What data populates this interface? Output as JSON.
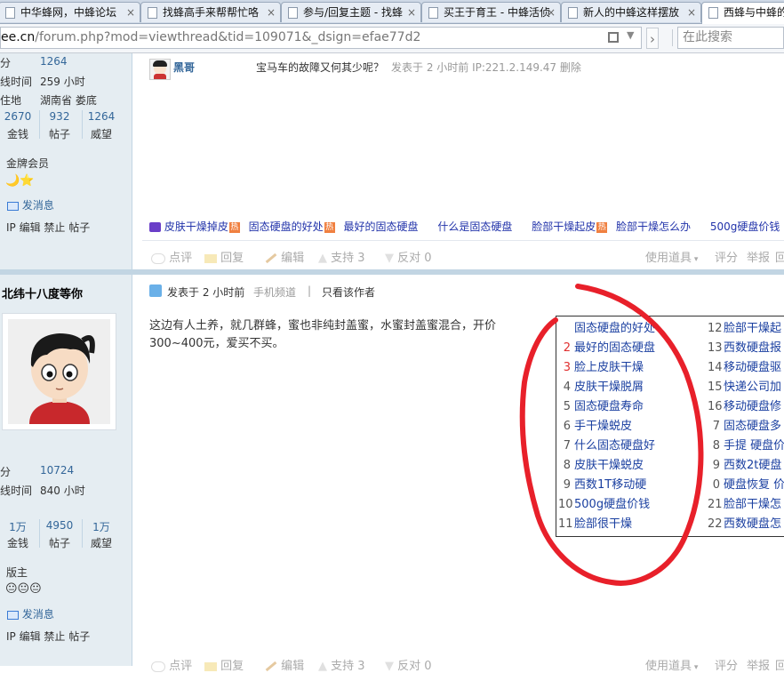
{
  "tabs": [
    {
      "title": "中华蜂网，中蜂论坛",
      "close": "×"
    },
    {
      "title": "找蜂高手来帮帮忙咯",
      "close": "×"
    },
    {
      "title": "参与/回复主题 - 找蜂",
      "close": "×"
    },
    {
      "title": "买王于育王 - 中蜂活侦",
      "close": "×"
    },
    {
      "title": "新人的中蜂这样摆放",
      "close": "×"
    },
    {
      "title": "西蜂与中蜂的",
      "close": ""
    }
  ],
  "address": {
    "host": "ee.cn",
    "path": "/forum.php?mod=viewthread&tid=109071&_dsign=efae77d2",
    "search_placeholder": "在此搜索",
    "forward": "›"
  },
  "user1": {
    "points_label": "分",
    "points": "1264",
    "online_label": "线时间",
    "online": "259 小时",
    "location_label": "住地",
    "location": "湖南省 娄底",
    "stats": [
      {
        "value": "2670",
        "label": "金钱"
      },
      {
        "value": "932",
        "label": "帖子"
      },
      {
        "value": "1264",
        "label": "威望"
      }
    ],
    "group": "金牌会员",
    "badges": "🌙⭐",
    "message": "发消息",
    "admin_links": "IP 编辑 禁止 帖子"
  },
  "reply": {
    "author": "黑哥",
    "quote": "宝马车的故障又何其少呢？",
    "meta": "发表于 2 小时前 IP:221.2.149.47 删除"
  },
  "ad_links": [
    {
      "text": "皮肤干燥掉皮",
      "hot": true
    },
    {
      "text": "固态硬盘的好处",
      "hot": true
    },
    {
      "text": "最好的固态硬盘",
      "hot": false
    },
    {
      "text": "什么是固态硬盘",
      "hot": false
    },
    {
      "text": "脸部干燥起皮",
      "hot": true
    },
    {
      "text": "脸部干燥怎么办",
      "hot": false
    },
    {
      "text": "500g硬盘价钱",
      "hot": false
    }
  ],
  "hot_label": "热",
  "actions": {
    "rate": "点评",
    "reply": "回复",
    "edit": "编辑",
    "support": "支持 3",
    "oppose": "反对 0",
    "tools": "使用道具",
    "score": "评分",
    "report": "举报",
    "top": "回"
  },
  "user2": {
    "name": "北纬十八度等你",
    "points_label": "分",
    "points": "10724",
    "online_label": "线时间",
    "online": "840 小时",
    "stats": [
      {
        "value": "1万",
        "label": "金钱"
      },
      {
        "value": "4950",
        "label": "帖子"
      },
      {
        "value": "1万",
        "label": "威望"
      }
    ],
    "group": "版主",
    "badges": "😐😐😐",
    "message": "发消息",
    "admin_links": "IP 编辑 禁止 帖子"
  },
  "post2": {
    "meta": "发表于 2 小时前",
    "channel": "手机频道",
    "divider": "|",
    "only_author": "只看该作者",
    "content_line1": "这边有人土养，就几群蜂，蜜也非纯封盖蜜，水蜜封盖蜜混合，开价",
    "content_line2": "300~400元，爱买不买。"
  },
  "ad_box": {
    "left": [
      {
        "n": "",
        "t": "固态硬盘的好处"
      },
      {
        "n": "2",
        "t": "最好的固态硬盘"
      },
      {
        "n": "3",
        "t": "脸上皮肤干燥"
      },
      {
        "n": "4",
        "t": "皮肤干燥脱屑"
      },
      {
        "n": "5",
        "t": "固态硬盘寿命"
      },
      {
        "n": "6",
        "t": "手干燥蜕皮"
      },
      {
        "n": "7",
        "t": "什么固态硬盘好"
      },
      {
        "n": "8",
        "t": "皮肤干燥蜕皮"
      },
      {
        "n": "9",
        "t": "西数1T移动硬"
      },
      {
        "n": "10",
        "t": "500g硬盘价钱"
      },
      {
        "n": "11",
        "t": "脸部很干燥"
      }
    ],
    "right": [
      {
        "n": "12",
        "t": "脸部干燥起"
      },
      {
        "n": "13",
        "t": "西数硬盘报"
      },
      {
        "n": "14",
        "t": "移动硬盘驱"
      },
      {
        "n": "15",
        "t": "快递公司加"
      },
      {
        "n": "16",
        "t": "移动硬盘修"
      },
      {
        "n": "7",
        "t": "固态硬盘多"
      },
      {
        "n": "8",
        "t": "手提 硬盘价"
      },
      {
        "n": "9",
        "t": "西数2t硬盘"
      },
      {
        "n": "0",
        "t": "硬盘恢复 价"
      },
      {
        "n": "21",
        "t": "脸部干燥怎"
      },
      {
        "n": "22",
        "t": "西数硬盘怎"
      }
    ]
  },
  "colors": {
    "link": "#336699",
    "sidebar": "#e5edf2",
    "annotation": "#e8202a",
    "rank_red": "#e03030"
  }
}
